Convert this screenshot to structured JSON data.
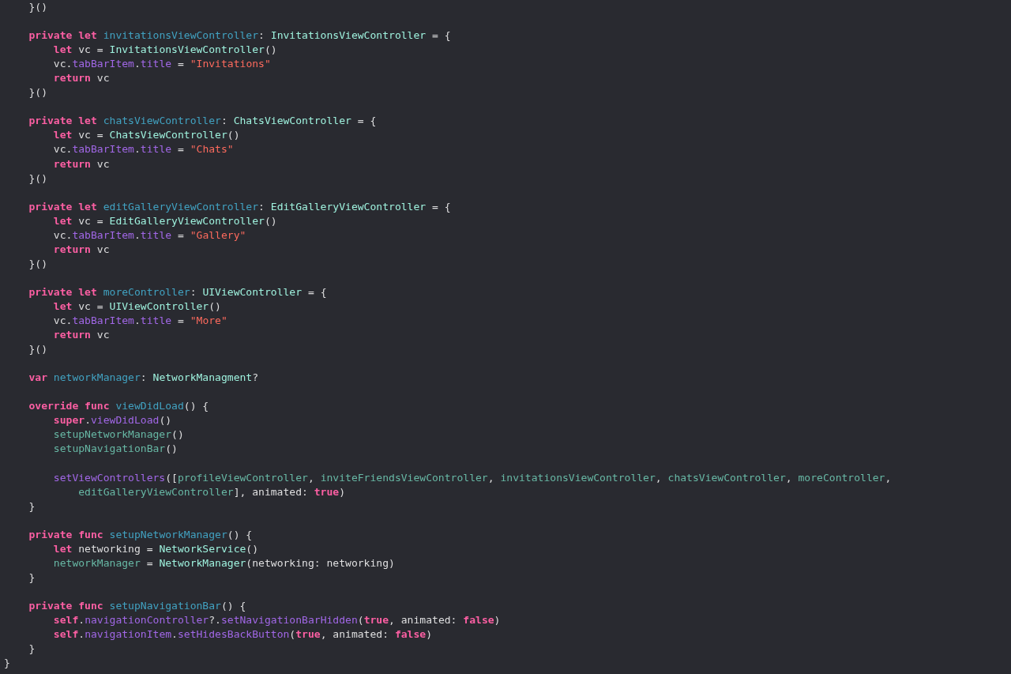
{
  "editor": {
    "lines": [
      {
        "kind": "code",
        "tokens": [
          {
            "kind": "plain",
            "text": "    }()"
          }
        ]
      },
      {
        "kind": "blank"
      },
      {
        "kind": "code",
        "tokens": [
          {
            "kind": "keyword",
            "text": "    private let "
          },
          {
            "kind": "decl",
            "text": "invitationsViewController"
          },
          {
            "kind": "plain",
            "text": ": "
          },
          {
            "kind": "type",
            "text": "InvitationsViewController"
          },
          {
            "kind": "plain",
            "text": " = {"
          }
        ]
      },
      {
        "kind": "code",
        "tokens": [
          {
            "kind": "keyword",
            "text": "        let"
          },
          {
            "kind": "plain",
            "text": " vc = "
          },
          {
            "kind": "type",
            "text": "InvitationsViewController"
          },
          {
            "kind": "plain",
            "text": "()"
          }
        ]
      },
      {
        "kind": "code",
        "tokens": [
          {
            "kind": "plain",
            "text": "        vc."
          },
          {
            "kind": "member",
            "text": "tabBarItem"
          },
          {
            "kind": "plain",
            "text": "."
          },
          {
            "kind": "member",
            "text": "title"
          },
          {
            "kind": "plain",
            "text": " = "
          },
          {
            "kind": "string",
            "text": "\"Invitations\""
          }
        ]
      },
      {
        "kind": "code",
        "tokens": [
          {
            "kind": "keyword",
            "text": "        return"
          },
          {
            "kind": "plain",
            "text": " vc"
          }
        ]
      },
      {
        "kind": "code",
        "tokens": [
          {
            "kind": "plain",
            "text": "    }()"
          }
        ]
      },
      {
        "kind": "blank"
      },
      {
        "kind": "code",
        "tokens": [
          {
            "kind": "keyword",
            "text": "    private let "
          },
          {
            "kind": "decl",
            "text": "chatsViewController"
          },
          {
            "kind": "plain",
            "text": ": "
          },
          {
            "kind": "type",
            "text": "ChatsViewController"
          },
          {
            "kind": "plain",
            "text": " = {"
          }
        ]
      },
      {
        "kind": "code",
        "tokens": [
          {
            "kind": "keyword",
            "text": "        let"
          },
          {
            "kind": "plain",
            "text": " vc = "
          },
          {
            "kind": "type",
            "text": "ChatsViewController"
          },
          {
            "kind": "plain",
            "text": "()"
          }
        ]
      },
      {
        "kind": "code",
        "tokens": [
          {
            "kind": "plain",
            "text": "        vc."
          },
          {
            "kind": "member",
            "text": "tabBarItem"
          },
          {
            "kind": "plain",
            "text": "."
          },
          {
            "kind": "member",
            "text": "title"
          },
          {
            "kind": "plain",
            "text": " = "
          },
          {
            "kind": "string",
            "text": "\"Chats\""
          }
        ]
      },
      {
        "kind": "code",
        "tokens": [
          {
            "kind": "keyword",
            "text": "        return"
          },
          {
            "kind": "plain",
            "text": " vc"
          }
        ]
      },
      {
        "kind": "code",
        "tokens": [
          {
            "kind": "plain",
            "text": "    }()"
          }
        ]
      },
      {
        "kind": "blank"
      },
      {
        "kind": "code",
        "tokens": [
          {
            "kind": "keyword",
            "text": "    private let "
          },
          {
            "kind": "decl",
            "text": "editGalleryViewController"
          },
          {
            "kind": "plain",
            "text": ": "
          },
          {
            "kind": "type",
            "text": "EditGalleryViewController"
          },
          {
            "kind": "plain",
            "text": " = {"
          }
        ]
      },
      {
        "kind": "code",
        "tokens": [
          {
            "kind": "keyword",
            "text": "        let"
          },
          {
            "kind": "plain",
            "text": " vc = "
          },
          {
            "kind": "type",
            "text": "EditGalleryViewController"
          },
          {
            "kind": "plain",
            "text": "()"
          }
        ]
      },
      {
        "kind": "code",
        "tokens": [
          {
            "kind": "plain",
            "text": "        vc."
          },
          {
            "kind": "member",
            "text": "tabBarItem"
          },
          {
            "kind": "plain",
            "text": "."
          },
          {
            "kind": "member",
            "text": "title"
          },
          {
            "kind": "plain",
            "text": " = "
          },
          {
            "kind": "string",
            "text": "\"Gallery\""
          }
        ]
      },
      {
        "kind": "code",
        "tokens": [
          {
            "kind": "keyword",
            "text": "        return"
          },
          {
            "kind": "plain",
            "text": " vc"
          }
        ]
      },
      {
        "kind": "code",
        "tokens": [
          {
            "kind": "plain",
            "text": "    }()"
          }
        ]
      },
      {
        "kind": "blank"
      },
      {
        "kind": "code",
        "tokens": [
          {
            "kind": "keyword",
            "text": "    private let "
          },
          {
            "kind": "decl",
            "text": "moreController"
          },
          {
            "kind": "plain",
            "text": ": "
          },
          {
            "kind": "type",
            "text": "UIViewController"
          },
          {
            "kind": "plain",
            "text": " = {"
          }
        ]
      },
      {
        "kind": "code",
        "tokens": [
          {
            "kind": "keyword",
            "text": "        let"
          },
          {
            "kind": "plain",
            "text": " vc = "
          },
          {
            "kind": "type",
            "text": "UIViewController"
          },
          {
            "kind": "plain",
            "text": "()"
          }
        ]
      },
      {
        "kind": "code",
        "tokens": [
          {
            "kind": "plain",
            "text": "        vc."
          },
          {
            "kind": "member",
            "text": "tabBarItem"
          },
          {
            "kind": "plain",
            "text": "."
          },
          {
            "kind": "member",
            "text": "title"
          },
          {
            "kind": "plain",
            "text": " = "
          },
          {
            "kind": "string",
            "text": "\"More\""
          }
        ]
      },
      {
        "kind": "code",
        "tokens": [
          {
            "kind": "keyword",
            "text": "        return"
          },
          {
            "kind": "plain",
            "text": " vc"
          }
        ]
      },
      {
        "kind": "code",
        "tokens": [
          {
            "kind": "plain",
            "text": "    }()"
          }
        ]
      },
      {
        "kind": "blank"
      },
      {
        "kind": "code",
        "tokens": [
          {
            "kind": "keyword",
            "text": "    var "
          },
          {
            "kind": "decl",
            "text": "networkManager"
          },
          {
            "kind": "plain",
            "text": ": "
          },
          {
            "kind": "type",
            "text": "NetworkManagment"
          },
          {
            "kind": "plain",
            "text": "?"
          }
        ]
      },
      {
        "kind": "blank"
      },
      {
        "kind": "code",
        "tokens": [
          {
            "kind": "keyword",
            "text": "    override func "
          },
          {
            "kind": "decl",
            "text": "viewDidLoad"
          },
          {
            "kind": "plain",
            "text": "() {"
          }
        ]
      },
      {
        "kind": "code",
        "tokens": [
          {
            "kind": "keyword",
            "text": "        super"
          },
          {
            "kind": "plain",
            "text": "."
          },
          {
            "kind": "member",
            "text": "viewDidLoad"
          },
          {
            "kind": "plain",
            "text": "()"
          }
        ]
      },
      {
        "kind": "code",
        "tokens": [
          {
            "kind": "ident",
            "text": "        setupNetworkManager"
          },
          {
            "kind": "plain",
            "text": "()"
          }
        ]
      },
      {
        "kind": "code",
        "tokens": [
          {
            "kind": "ident",
            "text": "        setupNavigationBar"
          },
          {
            "kind": "plain",
            "text": "()"
          }
        ]
      },
      {
        "kind": "blank"
      },
      {
        "kind": "code",
        "tokens": [
          {
            "kind": "member",
            "text": "        setViewControllers"
          },
          {
            "kind": "plain",
            "text": "(["
          },
          {
            "kind": "ident",
            "text": "profileViewController"
          },
          {
            "kind": "plain",
            "text": ", "
          },
          {
            "kind": "ident",
            "text": "inviteFriendsViewController"
          },
          {
            "kind": "plain",
            "text": ", "
          },
          {
            "kind": "ident",
            "text": "invitationsViewController"
          },
          {
            "kind": "plain",
            "text": ", "
          },
          {
            "kind": "ident",
            "text": "chatsViewController"
          },
          {
            "kind": "plain",
            "text": ", "
          },
          {
            "kind": "ident",
            "text": "moreController"
          },
          {
            "kind": "plain",
            "text": ","
          }
        ]
      },
      {
        "kind": "code",
        "tokens": [
          {
            "kind": "ident",
            "text": "            editGalleryViewController"
          },
          {
            "kind": "plain",
            "text": "], animated: "
          },
          {
            "kind": "keyword",
            "text": "true"
          },
          {
            "kind": "plain",
            "text": ")"
          }
        ]
      },
      {
        "kind": "code",
        "tokens": [
          {
            "kind": "plain",
            "text": "    }"
          }
        ]
      },
      {
        "kind": "blank"
      },
      {
        "kind": "code",
        "tokens": [
          {
            "kind": "keyword",
            "text": "    private func "
          },
          {
            "kind": "decl",
            "text": "setupNetworkManager"
          },
          {
            "kind": "plain",
            "text": "() {"
          }
        ]
      },
      {
        "kind": "code",
        "tokens": [
          {
            "kind": "keyword",
            "text": "        let"
          },
          {
            "kind": "plain",
            "text": " networking = "
          },
          {
            "kind": "type",
            "text": "NetworkService"
          },
          {
            "kind": "plain",
            "text": "()"
          }
        ]
      },
      {
        "kind": "code",
        "tokens": [
          {
            "kind": "ident",
            "text": "        networkManager"
          },
          {
            "kind": "plain",
            "text": " = "
          },
          {
            "kind": "type",
            "text": "NetworkManager"
          },
          {
            "kind": "plain",
            "text": "(networking: networking)"
          }
        ]
      },
      {
        "kind": "code",
        "tokens": [
          {
            "kind": "plain",
            "text": "    }"
          }
        ]
      },
      {
        "kind": "blank"
      },
      {
        "kind": "code",
        "tokens": [
          {
            "kind": "keyword",
            "text": "    private func "
          },
          {
            "kind": "decl",
            "text": "setupNavigationBar"
          },
          {
            "kind": "plain",
            "text": "() {"
          }
        ]
      },
      {
        "kind": "code",
        "tokens": [
          {
            "kind": "keyword",
            "text": "        self"
          },
          {
            "kind": "plain",
            "text": "."
          },
          {
            "kind": "member",
            "text": "navigationController"
          },
          {
            "kind": "plain",
            "text": "?."
          },
          {
            "kind": "member",
            "text": "setNavigationBarHidden"
          },
          {
            "kind": "plain",
            "text": "("
          },
          {
            "kind": "keyword",
            "text": "true"
          },
          {
            "kind": "plain",
            "text": ", animated: "
          },
          {
            "kind": "keyword",
            "text": "false"
          },
          {
            "kind": "plain",
            "text": ")"
          }
        ]
      },
      {
        "kind": "code",
        "tokens": [
          {
            "kind": "keyword",
            "text": "        self"
          },
          {
            "kind": "plain",
            "text": "."
          },
          {
            "kind": "member",
            "text": "navigationItem"
          },
          {
            "kind": "plain",
            "text": "."
          },
          {
            "kind": "member",
            "text": "setHidesBackButton"
          },
          {
            "kind": "plain",
            "text": "("
          },
          {
            "kind": "keyword",
            "text": "true"
          },
          {
            "kind": "plain",
            "text": ", animated: "
          },
          {
            "kind": "keyword",
            "text": "false"
          },
          {
            "kind": "plain",
            "text": ")"
          }
        ]
      },
      {
        "kind": "code",
        "tokens": [
          {
            "kind": "plain",
            "text": "    }"
          }
        ]
      },
      {
        "kind": "code",
        "tokens": [
          {
            "kind": "plain",
            "text": "}"
          }
        ]
      }
    ]
  }
}
